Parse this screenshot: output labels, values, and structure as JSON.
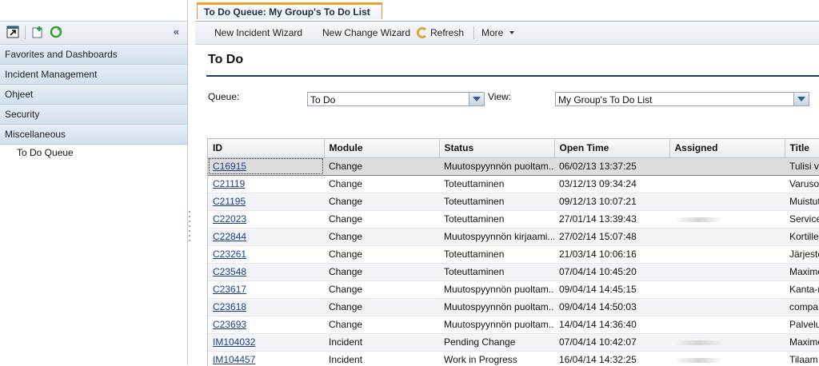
{
  "sidebar": {
    "sections": [
      {
        "label": "Favorites and Dashboards"
      },
      {
        "label": "Incident Management"
      },
      {
        "label": "Ohjeet"
      },
      {
        "label": "Security"
      },
      {
        "label": "Miscellaneous"
      }
    ],
    "sub_item": "To Do Queue",
    "collapse_glyph": "«"
  },
  "tab": {
    "label": "To Do Queue: My Group's To Do List"
  },
  "actions": {
    "new_incident": "New Incident Wizard",
    "new_change": "New Change Wizard",
    "refresh": "Refresh",
    "more": "More"
  },
  "page": {
    "heading": "To Do"
  },
  "filters": {
    "queue_label": "Queue:",
    "queue_value": "To Do",
    "view_label": "View:",
    "view_value": "My Group's To Do List"
  },
  "table": {
    "columns": [
      "ID",
      "Module",
      "Status",
      "Open Time",
      "Assigned",
      "Title"
    ],
    "rows": [
      {
        "id": "C16915",
        "module": "Change",
        "status": "Muutospyynnön puoltam...",
        "open": "06/02/13 13:37:25",
        "assigned": "",
        "title": "Tulisi v"
      },
      {
        "id": "C21119",
        "module": "Change",
        "status": "Toteuttaminen",
        "open": "03/12/13 09:34:24",
        "assigned": "",
        "title": "Varuso"
      },
      {
        "id": "C21195",
        "module": "Change",
        "status": "Toteuttaminen",
        "open": "09/12/13 10:07:21",
        "assigned": "",
        "title": "Muistut"
      },
      {
        "id": "C22023",
        "module": "Change",
        "status": "Toteuttaminen",
        "open": "27/01/14 13:39:43",
        "assigned": "",
        "title": "Service"
      },
      {
        "id": "C22844",
        "module": "Change",
        "status": "Muutospyynnön kirjaami...",
        "open": "27/02/14 15:07:48",
        "assigned": "",
        "title": "Kortille"
      },
      {
        "id": "C23261",
        "module": "Change",
        "status": "Toteuttaminen",
        "open": "21/03/14 10:06:16",
        "assigned": "",
        "title": "Järjeste"
      },
      {
        "id": "C23548",
        "module": "Change",
        "status": "Toteuttaminen",
        "open": "07/04/14 10:45:20",
        "assigned": "",
        "title": "Maximo"
      },
      {
        "id": "C23617",
        "module": "Change",
        "status": "Muutospyynnön puoltam...",
        "open": "09/04/14 14:45:15",
        "assigned": "",
        "title": "Kanta-r"
      },
      {
        "id": "C23618",
        "module": "Change",
        "status": "Muutospyynnön puoltam...",
        "open": "09/04/14 14:50:03",
        "assigned": "",
        "title": "compa"
      },
      {
        "id": "C23693",
        "module": "Change",
        "status": "Muutospyynnön puoltam...",
        "open": "14/04/14 14:36:40",
        "assigned": "",
        "title": "Palvelu"
      },
      {
        "id": "IM104032",
        "module": "Incident",
        "status": "Pending Change",
        "open": "07/04/14 10:42:07",
        "assigned": "",
        "title": "Maximo"
      },
      {
        "id": "IM104457",
        "module": "Incident",
        "status": "Work in Progress",
        "open": "16/04/14 14:32:25",
        "assigned": "",
        "title": "Tilaam"
      }
    ]
  }
}
